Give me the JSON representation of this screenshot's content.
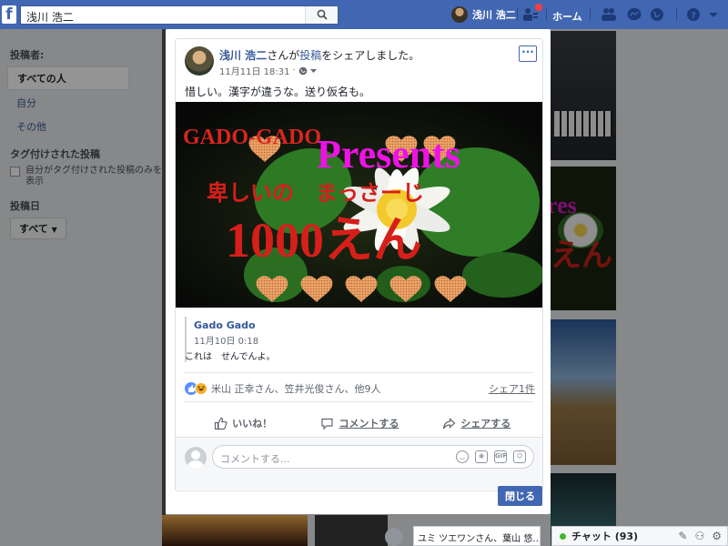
{
  "topbar": {
    "search_value": "浅川 浩二",
    "profile_name": "浅川 浩二",
    "home_label": "ホーム"
  },
  "sidebar": {
    "poster_heading": "投稿者:",
    "poster_items": [
      "すべての人",
      "自分",
      "その他"
    ],
    "tagged_heading": "タグ付けされた投稿",
    "tagged_checkbox_label": "自分がタグ付けされた投稿のみを表示",
    "date_heading": "投稿日",
    "date_dropdown": "すべて"
  },
  "post": {
    "author": "浅川 浩二",
    "action_text": "さんが",
    "action_link": "投稿",
    "action_suffix": "をシェアしました。",
    "timestamp": "11月11日 18:31",
    "meta_sep": "·",
    "text": "惜しい。漢字が違うな。送り仮名も。",
    "image": {
      "line1": "GADO-GADO",
      "line2": "Presents",
      "line3": "卑しいの　まっさーじ",
      "line4": "1000えん"
    },
    "shared_from": {
      "name": "Gado Gado",
      "date": "11月10日 0:18",
      "text": "これは　せんでんよ。"
    },
    "reactions_text": "米山 正幸さん、笠井光俊さん、他9人",
    "share_count": "シェア1件",
    "like_label": "いいね！",
    "comment_label": "コメントする",
    "share_label": "シェアする",
    "comment_placeholder": "コメントする..."
  },
  "modal": {
    "close_label": "閉じる"
  },
  "bottom": {
    "toast_text": "ユミ ツエワンさん、葉山 悠…",
    "chat_label": "チャット (93)"
  },
  "colors": {
    "brand": "#4267b2",
    "link": "#365899",
    "image_title_red": "#e0241d",
    "image_presents_magenta": "#e80fe0"
  }
}
